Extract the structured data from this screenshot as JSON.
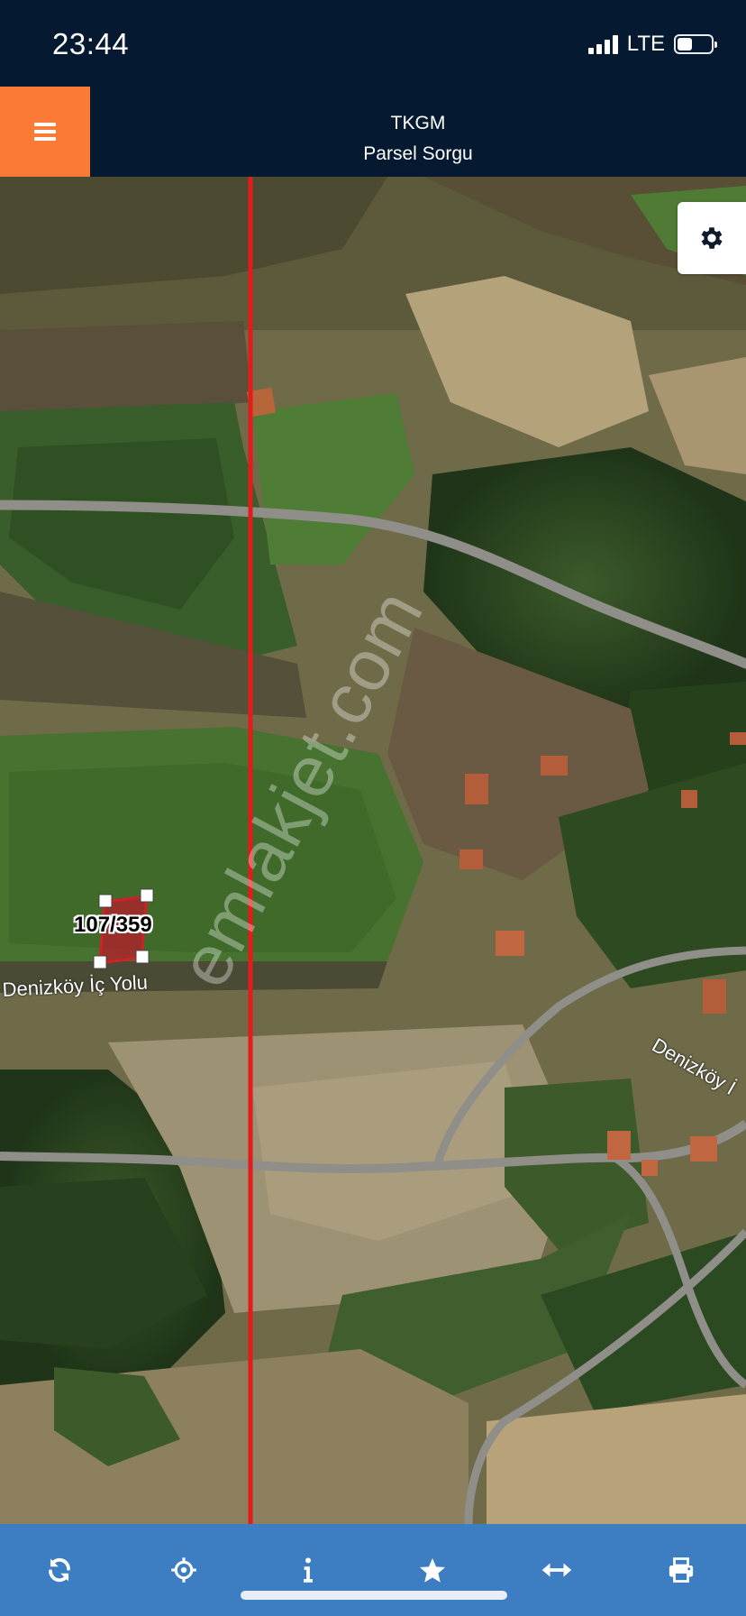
{
  "status_bar": {
    "time": "23:44",
    "network": "LTE",
    "signal_bars": 4,
    "battery_level": 0.45
  },
  "header": {
    "menu_icon": "hamburger-menu-icon",
    "title": "TKGM",
    "subtitle": "Parsel Sorgu"
  },
  "map": {
    "settings_icon": "gear-icon",
    "watermark": "emlakjet.com",
    "parcel_label": "107/359",
    "road_labels": [
      "Denizköy İç Yolu",
      "Denizköy İ"
    ],
    "colors": {
      "reference_line": "#e51b1b",
      "parcel_fill": "#b0202a",
      "road": "#8e8e88"
    }
  },
  "toolbar": {
    "items": [
      {
        "icon": "refresh-icon"
      },
      {
        "icon": "locate-crosshair-icon"
      },
      {
        "icon": "info-icon"
      },
      {
        "icon": "star-icon"
      },
      {
        "icon": "measure-arrows-icon"
      },
      {
        "icon": "print-icon"
      }
    ],
    "color": "#3d7ec2"
  }
}
